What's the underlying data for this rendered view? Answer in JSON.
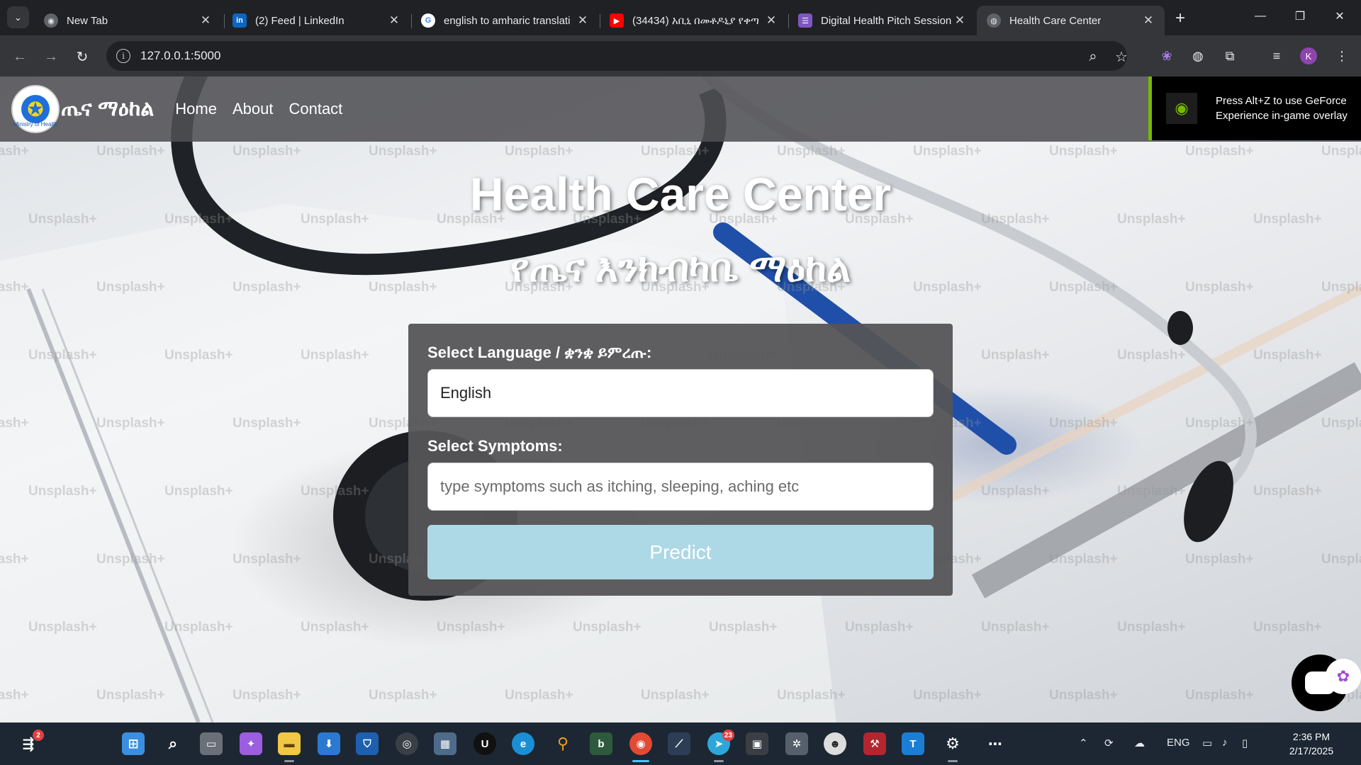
{
  "browser": {
    "tabs": [
      {
        "title": "New Tab",
        "favicon": "chrome-icon",
        "color": "#9aa0a6",
        "active": false
      },
      {
        "title": "(2) Feed | LinkedIn",
        "favicon": "linkedin-icon",
        "color": "#0a66c2",
        "active": false
      },
      {
        "title": "english to amharic translati",
        "favicon": "google-icon",
        "color": "#ffffff",
        "active": false
      },
      {
        "title": "(34434) አቢኒ በመቶዶኒያ የቀጣ",
        "favicon": "youtube-icon",
        "color": "#ff0000",
        "active": false
      },
      {
        "title": "Digital Health Pitch Session",
        "favicon": "forms-icon",
        "color": "#7e57c2",
        "active": false
      },
      {
        "title": "Health Care Center",
        "favicon": "globe-icon",
        "color": "#9aa0a6",
        "active": true
      }
    ],
    "url": "127.0.0.1:5000"
  },
  "site": {
    "brand": "ጤና ማዕከል",
    "logo_subtext": "Ministry of Health",
    "nav": [
      "Home",
      "About",
      "Contact"
    ],
    "title_en": "Health Care Center",
    "title_am": "የጤና እንክብካቤ ማዕከል",
    "form": {
      "language_label": "Select Language / ቋንቋ ይምረጡ:",
      "language_value": "English",
      "symptoms_label": "Select Symptoms:",
      "symptoms_placeholder": "type symptoms such as itching, sleeping, aching etc",
      "predict_label": "Predict"
    },
    "watermark": "Unsplash+"
  },
  "overlay": {
    "nvidia_text": "Press Alt+Z to use GeForce Experience in-game overlay"
  },
  "taskbar": {
    "notification_badge": "2",
    "telegram_badge": "23",
    "language": "ENG",
    "time": "2:36 PM",
    "date": "2/17/2025"
  },
  "colors": {
    "predict_button": "#add8e6",
    "nvidia_green": "#76b900",
    "card_bg": "#555456"
  }
}
